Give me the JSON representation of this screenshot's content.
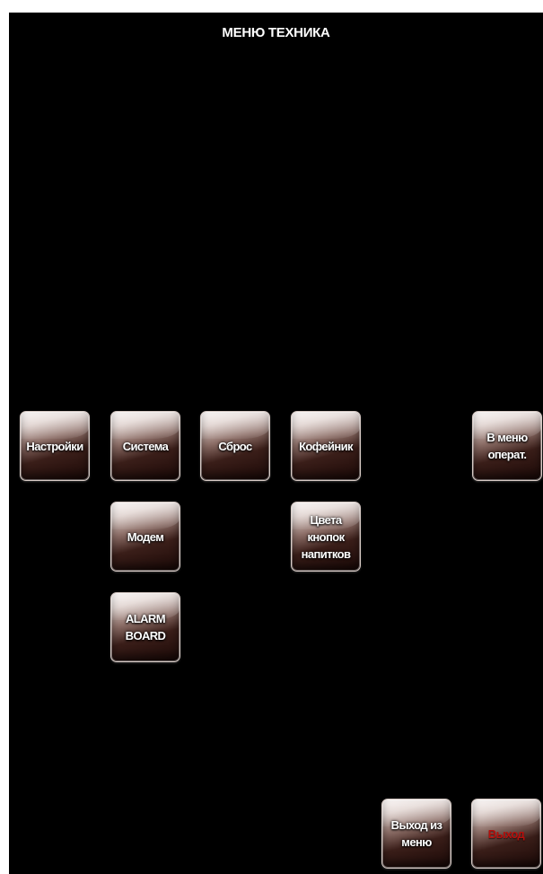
{
  "header": {
    "title": "МЕНЮ ТЕХНИКА"
  },
  "buttons": {
    "settings": "Настройки",
    "system": "Система",
    "reset": "Сброс",
    "coffee_maker": "Кофейник",
    "operator_menu": "В меню\nоперат.",
    "modem": "Модем",
    "drink_button_colors": "Цвета\nкнопок\nнапитков",
    "alarm_board": "ALARM\nBOARD",
    "exit_menu": "Выход из\nменю",
    "exit": "Выход"
  },
  "colors": {
    "background": "#000000",
    "text": "#ffffff",
    "exit_text": "#b5100d"
  }
}
